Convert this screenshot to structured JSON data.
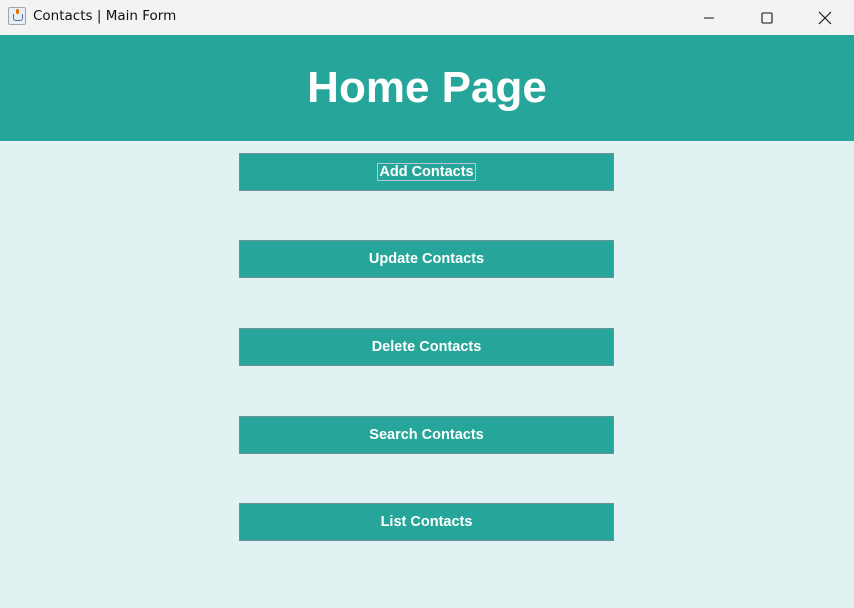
{
  "window": {
    "title": "Contacts | Main Form",
    "icon": "java-cup-icon"
  },
  "header": {
    "title": "Home Page"
  },
  "buttons": [
    {
      "label": "Add Contacts",
      "focused": true
    },
    {
      "label": "Update Contacts"
    },
    {
      "label": "Delete Contacts"
    },
    {
      "label": "Search Contacts"
    },
    {
      "label": "List Contacts"
    }
  ],
  "colors": {
    "accent": "#26a69a",
    "background": "#e0f2f1",
    "text": "#ffffff"
  }
}
